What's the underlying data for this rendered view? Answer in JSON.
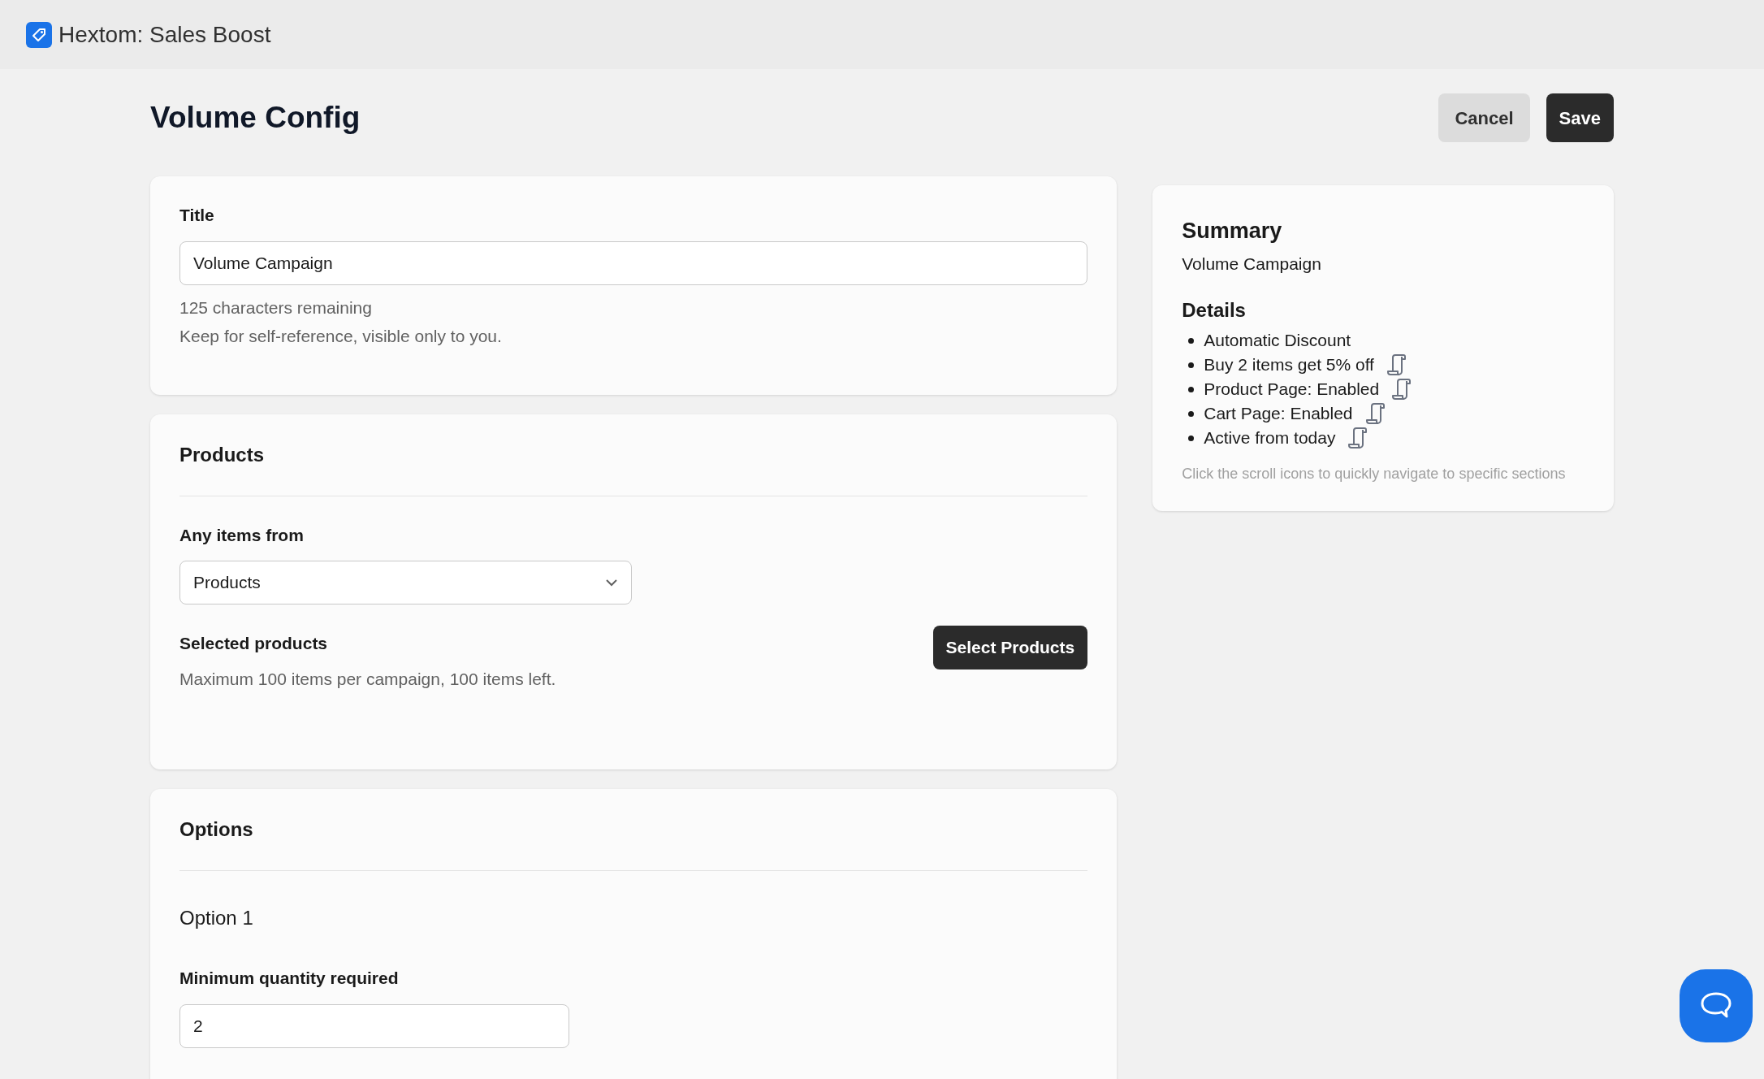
{
  "app_bar": {
    "title": "Hextom: Sales Boost"
  },
  "page": {
    "title": "Volume Config",
    "actions": [
      {
        "label": "Cancel",
        "kind": "secondary"
      },
      {
        "label": "Save",
        "kind": "primary"
      }
    ]
  },
  "title_card": {
    "label": "Title",
    "value": "Volume Campaign",
    "counter": "125 characters remaining",
    "hint": "Keep for self-reference, visible only to you."
  },
  "products_card": {
    "heading": "Products",
    "source_label": "Any items from",
    "source_value": "Products",
    "selected_label": "Selected products",
    "selected_hint": "Maximum 100 items per campaign, 100 items left.",
    "select_button": "Select Products"
  },
  "options_card": {
    "heading": "Options",
    "option_title": "Option 1",
    "quantity_label": "Minimum quantity required",
    "quantity_value": "2"
  },
  "summary": {
    "heading": "Summary",
    "name": "Volume Campaign",
    "details_heading": "Details",
    "details": [
      {
        "text": "Automatic Discount",
        "scroll_link": false
      },
      {
        "text": "Buy 2 items get 5% off",
        "scroll_link": true
      },
      {
        "text": "Product Page: Enabled",
        "scroll_link": true
      },
      {
        "text": "Cart Page: Enabled",
        "scroll_link": true
      },
      {
        "text": "Active from today",
        "scroll_link": true
      }
    ],
    "note": "Click the scroll icons to quickly navigate to specific sections"
  }
}
